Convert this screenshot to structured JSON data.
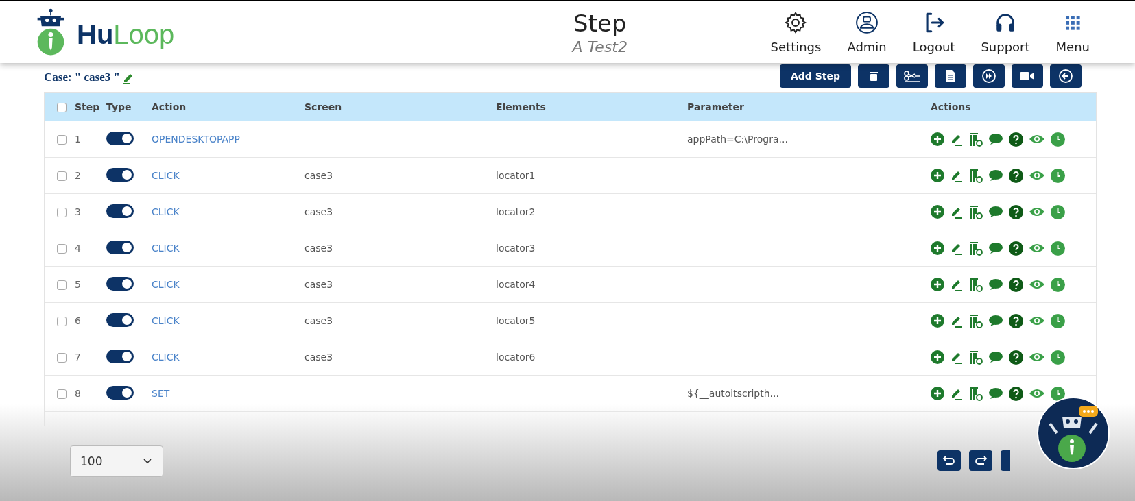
{
  "header": {
    "brand": {
      "part1": "Hu",
      "part2": "Loop"
    },
    "title": "Step",
    "subtitle": "A Test2",
    "nav": [
      {
        "kind": "settings",
        "label": "Settings"
      },
      {
        "kind": "admin",
        "label": "Admin"
      },
      {
        "kind": "logout",
        "label": "Logout"
      },
      {
        "kind": "support",
        "label": "Support"
      },
      {
        "kind": "menu",
        "label": "Menu"
      }
    ]
  },
  "case": {
    "label": "Case:",
    "name": "\" case3 \""
  },
  "toolbar": [
    {
      "kind": "text",
      "label": "Add Step"
    },
    {
      "kind": "trash"
    },
    {
      "kind": "cut"
    },
    {
      "kind": "paste"
    },
    {
      "kind": "run"
    },
    {
      "kind": "record"
    },
    {
      "kind": "back"
    }
  ],
  "table": {
    "select_all_checked": false,
    "columns": [
      "Step",
      "Type",
      "Action",
      "Screen",
      "Elements",
      "Parameter",
      "Actions"
    ],
    "rows": [
      {
        "checked": false,
        "step": "1",
        "on": true,
        "action": "OPENDESKTOPAPP",
        "screen": "",
        "elements": "",
        "parameter": "appPath=C:\\Progra..."
      },
      {
        "checked": false,
        "step": "2",
        "on": true,
        "action": "CLICK",
        "screen": "case3",
        "elements": "locator1",
        "parameter": ""
      },
      {
        "checked": false,
        "step": "3",
        "on": true,
        "action": "CLICK",
        "screen": "case3",
        "elements": "locator2",
        "parameter": ""
      },
      {
        "checked": false,
        "step": "4",
        "on": true,
        "action": "CLICK",
        "screen": "case3",
        "elements": "locator3",
        "parameter": ""
      },
      {
        "checked": false,
        "step": "5",
        "on": true,
        "action": "CLICK",
        "screen": "case3",
        "elements": "locator4",
        "parameter": ""
      },
      {
        "checked": false,
        "step": "6",
        "on": true,
        "action": "CLICK",
        "screen": "case3",
        "elements": "locator5",
        "parameter": ""
      },
      {
        "checked": false,
        "step": "7",
        "on": true,
        "action": "CLICK",
        "screen": "case3",
        "elements": "locator6",
        "parameter": ""
      },
      {
        "checked": false,
        "step": "8",
        "on": true,
        "action": "SET",
        "screen": "",
        "elements": "",
        "parameter": "${__autoitscripth..."
      }
    ]
  },
  "page_size": "100"
}
